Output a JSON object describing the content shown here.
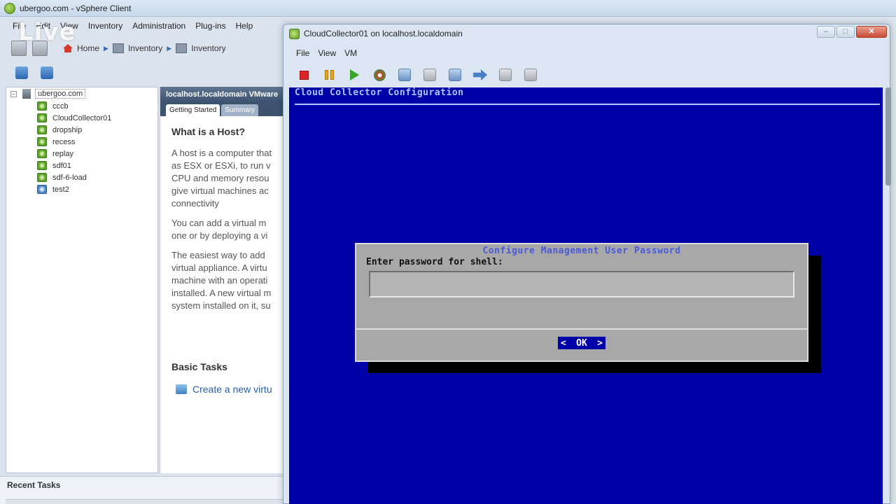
{
  "main_window": {
    "title": "ubergoo.com - vSphere Client",
    "menu": [
      "File",
      "Edit",
      "View",
      "Inventory",
      "Administration",
      "Plug-ins",
      "Help"
    ],
    "watermark": "Live",
    "breadcrumb": [
      "Home",
      "Inventory",
      "Inventory"
    ]
  },
  "inventory_tree": {
    "root": "ubergoo.com",
    "items": [
      {
        "label": "cccb",
        "state": "on"
      },
      {
        "label": "CloudCollector01",
        "state": "on"
      },
      {
        "label": "dropship",
        "state": "on"
      },
      {
        "label": "recess",
        "state": "on"
      },
      {
        "label": "replay",
        "state": "on"
      },
      {
        "label": "sdf01",
        "state": "on"
      },
      {
        "label": "sdf-6-load",
        "state": "on"
      },
      {
        "label": "test2",
        "state": "off"
      }
    ]
  },
  "content": {
    "header": "localhost.localdomain VMware",
    "tabs": [
      "Getting Started",
      "Summary"
    ],
    "heading": "What is a Host?",
    "paragraphs": [
      "A host is a computer that\nas ESX or ESXi, to run v\nCPU and memory resou\ngive virtual machines ac\nconnectivity",
      "You can add a virtual m\none or by deploying a vi",
      "The easiest way to add\nvirtual appliance. A virtu\nmachine with an operati\ninstalled. A new virtual m\nsystem installed on it, su"
    ],
    "basic_tasks_heading": "Basic Tasks",
    "task_link": "Create a new virtu"
  },
  "recent_tasks": {
    "title": "Recent Tasks"
  },
  "console": {
    "title": "CloudCollector01 on localhost.localdomain",
    "menu": [
      "File",
      "View",
      "VM"
    ],
    "window_controls": {
      "minimize": "–",
      "maximize": "□",
      "close": "✕"
    },
    "screen_title": "Cloud Collector Configuration",
    "dialog": {
      "title": "Configure Management User Password",
      "prompt": "Enter password for shell:",
      "input_value": "",
      "ok_label": "OK",
      "ok_left": "<",
      "ok_right": ">"
    }
  },
  "colors": {
    "console_bg": "#0000a8",
    "dialog_bg": "#a8a8a8",
    "dialog_title": "#4a5bd8"
  },
  "icons": {
    "stop": "stop-icon",
    "pause": "pause-icon",
    "play": "power-on-icon",
    "reset": "reset-icon",
    "snapshot": "snapshot-icon",
    "revert": "revert-snapshot-icon",
    "manage": "snapshot-manager-icon",
    "ctrl_alt_del": "send-ctrl-alt-del-icon",
    "cd": "cd-rom-icon",
    "floppy": "floppy-icon"
  }
}
